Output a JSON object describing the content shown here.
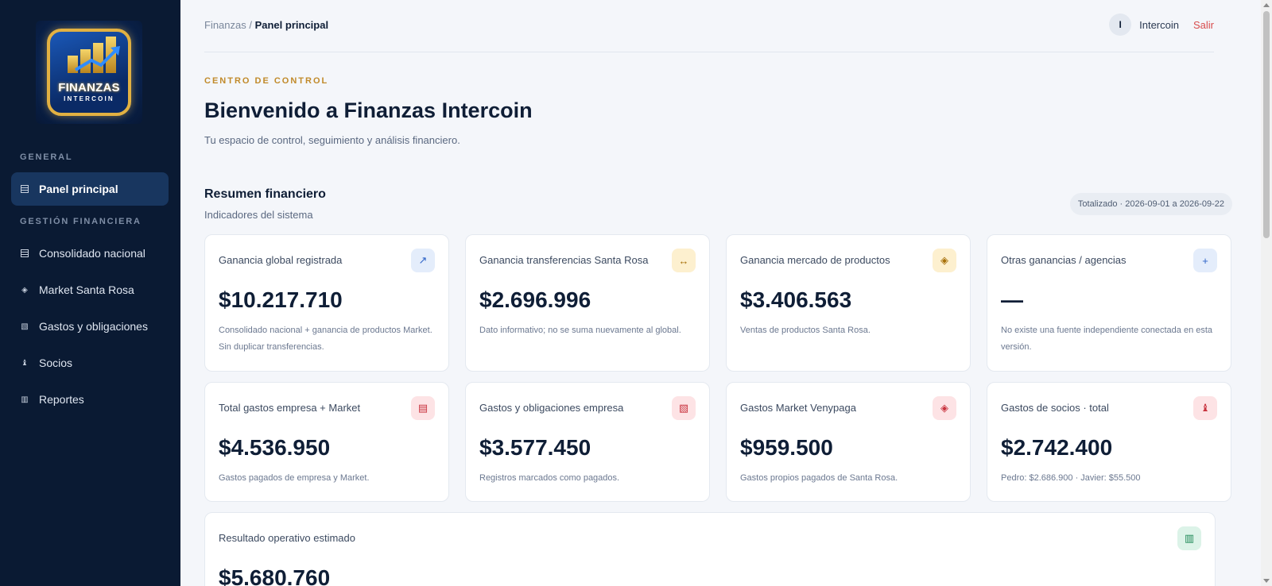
{
  "sidebar": {
    "logo": {
      "line1": "FINANZAS",
      "line2": "INTERCOIN"
    },
    "section_general": "GENERAL",
    "section_gestion": "GESTIÓN FINANCIERA",
    "items": [
      {
        "label": "Panel principal",
        "icon": "grid-icon",
        "active": true
      },
      {
        "label": "Consolidado nacional",
        "icon": "list-icon"
      },
      {
        "label": "Market Santa Rosa",
        "icon": "diamond-icon"
      },
      {
        "label": "Gastos y obligaciones",
        "icon": "hatch-icon"
      },
      {
        "label": "Socios",
        "icon": "person-icon"
      },
      {
        "label": "Reportes",
        "icon": "table-icon"
      }
    ]
  },
  "header": {
    "breadcrumb_root": "Finanzas",
    "breadcrumb_sep": " / ",
    "breadcrumb_current": "Panel principal",
    "avatar_letter": "I",
    "user_name": "Intercoin",
    "logout": "Salir"
  },
  "hero": {
    "eyebrow": "CENTRO DE CONTROL",
    "title": "Bienvenido a Finanzas Intercoin",
    "subtitle": "Tu espacio de control, seguimiento y análisis financiero."
  },
  "summary": {
    "title": "Resumen financiero",
    "subtitle": "Indicadores del sistema",
    "period": "Totalizado · 2026-09-01 a 2026-09-22"
  },
  "cards": [
    {
      "label": "Ganancia global registrada",
      "value": "$10.217.710",
      "note": "Consolidado nacional + ganancia de productos Market. Sin duplicar transferencias.",
      "icon": "↗",
      "icon_name": "trend-up-icon"
    },
    {
      "label": "Ganancia transferencias Santa Rosa",
      "value": "$2.696.996",
      "note": "Dato informativo; no se suma nuevamente al global.",
      "icon": "↔",
      "icon_name": "transfer-icon"
    },
    {
      "label": "Ganancia mercado de productos",
      "value": "$3.406.563",
      "note": "Ventas de productos Santa Rosa.",
      "icon": "◈",
      "icon_name": "diamond-icon"
    },
    {
      "label": "Otras ganancias / agencias",
      "value": "—",
      "note": "No existe una fuente independiente conectada en esta versión.",
      "icon": "+",
      "icon_name": "plus-icon"
    },
    {
      "label": "Total gastos empresa + Market",
      "value": "$4.536.950",
      "note": "Gastos pagados de empresa y Market.",
      "icon": "▤",
      "icon_name": "list-icon"
    },
    {
      "label": "Gastos y obligaciones empresa",
      "value": "$3.577.450",
      "note": "Registros marcados como pagados.",
      "icon": "▧",
      "icon_name": "hatch-icon"
    },
    {
      "label": "Gastos Market Venypaga",
      "value": "$959.500",
      "note": "Gastos propios pagados de Santa Rosa.",
      "icon": "◈",
      "icon_name": "diamond-icon"
    },
    {
      "label": "Gastos de socios · total",
      "value": "$2.742.400",
      "note": "Pedro: $2.686.900 · Javier: $55.500",
      "icon": "♝",
      "icon_name": "person-icon"
    }
  ],
  "operating": {
    "label": "Resultado operativo estimado",
    "value": "$5.680.760",
    "icon": "▥",
    "icon_name": "table-icon"
  }
}
